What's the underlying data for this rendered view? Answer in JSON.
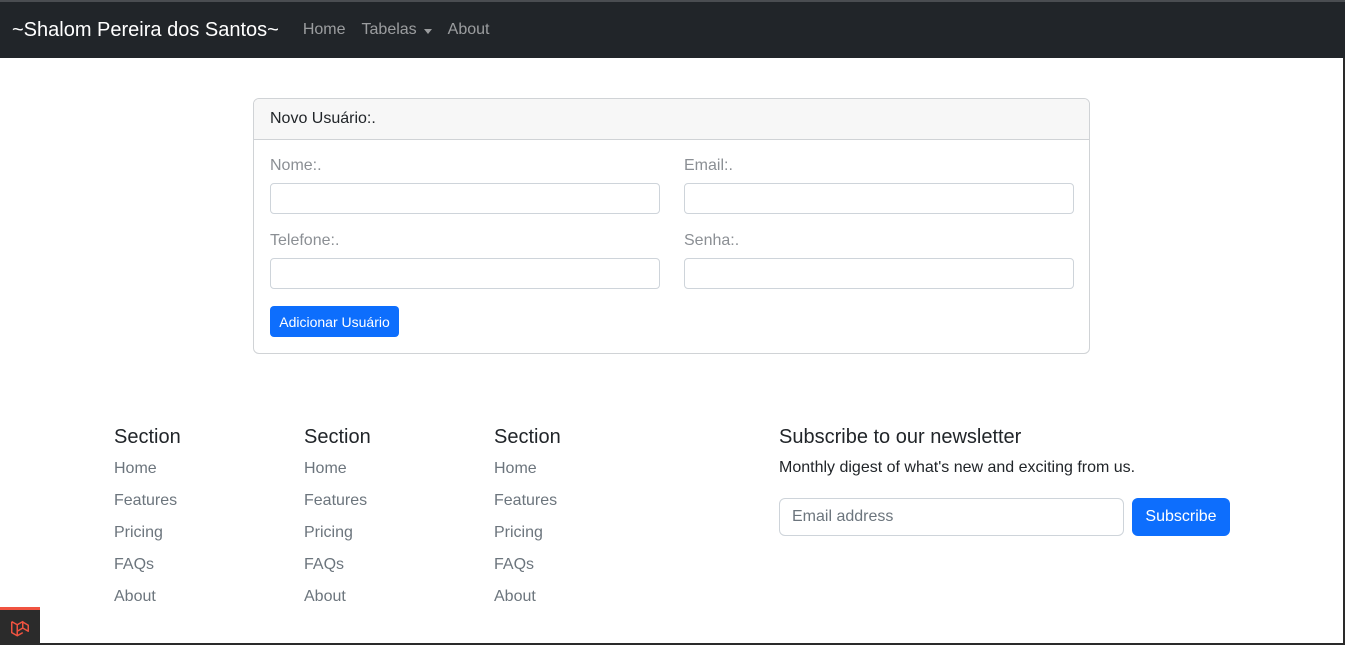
{
  "navbar": {
    "brand": "~Shalom Pereira dos Santos~",
    "links": [
      {
        "label": "Home"
      },
      {
        "label": "Tabelas"
      },
      {
        "label": "About"
      }
    ]
  },
  "card": {
    "header": "Novo Usuário:.",
    "fields": {
      "nome": {
        "label": "Nome:.",
        "value": ""
      },
      "email": {
        "label": "Email:.",
        "value": ""
      },
      "telefone": {
        "label": "Telefone:.",
        "value": ""
      },
      "senha": {
        "label": "Senha:.",
        "value": ""
      }
    },
    "submit_label": "Adicionar Usuário"
  },
  "footer": {
    "columns": [
      {
        "title": "Section",
        "links": [
          "Home",
          "Features",
          "Pricing",
          "FAQs",
          "About"
        ]
      },
      {
        "title": "Section",
        "links": [
          "Home",
          "Features",
          "Pricing",
          "FAQs",
          "About"
        ]
      },
      {
        "title": "Section",
        "links": [
          "Home",
          "Features",
          "Pricing",
          "FAQs",
          "About"
        ]
      }
    ],
    "newsletter": {
      "title": "Subscribe to our newsletter",
      "description": "Monthly digest of what's new and exciting from us.",
      "email_placeholder": "Email address",
      "button_label": "Subscribe"
    }
  },
  "icons": {
    "debugbar": "laravel-icon"
  },
  "colors": {
    "navbar_bg": "#212529",
    "primary": "#0d6efd",
    "laravel_red": "#f05340"
  }
}
